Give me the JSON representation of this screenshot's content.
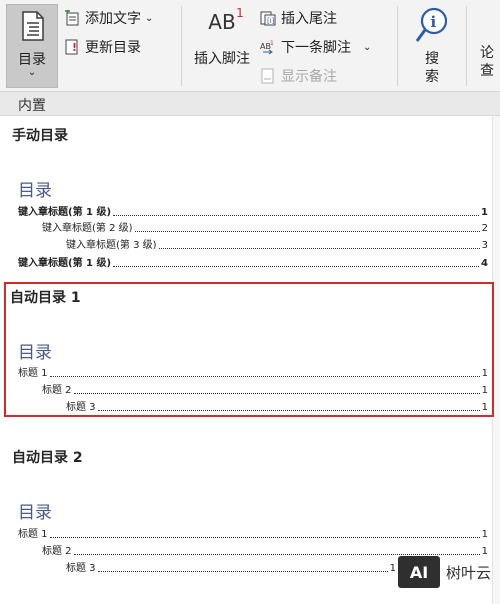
{
  "ribbon": {
    "toc_button_label": "目录",
    "add_text_label": "添加文字",
    "update_toc_label": "更新目录",
    "insert_footnote_label": "插入脚注",
    "insert_endnote_label": "插入尾注",
    "next_footnote_label": "下一条脚注",
    "show_notes_label": "显示备注",
    "search_label_1": "搜",
    "search_label_2": "索",
    "cut_label_1": "论",
    "cut_label_2": "查"
  },
  "gallery": {
    "header": "内置",
    "manual": {
      "section_title": "手动目录",
      "heading": "目录",
      "entries": [
        {
          "text": "键入章标题(第 1 级)",
          "page": "1"
        },
        {
          "text": "键入章标题(第 2 级)",
          "page": "2"
        },
        {
          "text": "键入章标题(第 3 级)",
          "page": "3"
        },
        {
          "text": "键入章标题(第 1 级)",
          "page": "4"
        }
      ]
    },
    "auto1": {
      "section_title": "自动目录 1",
      "heading": "目录",
      "entries": [
        {
          "text": "标题 1",
          "page": "1"
        },
        {
          "text": "标题 2",
          "page": "1"
        },
        {
          "text": "标题 3",
          "page": "1"
        }
      ]
    },
    "auto2": {
      "section_title": "自动目录 2",
      "heading": "目录",
      "entries": [
        {
          "text": "标题 1",
          "page": "1"
        },
        {
          "text": "标题 2",
          "page": "1"
        },
        {
          "text": "标题 3",
          "page": "1"
        }
      ]
    }
  },
  "watermark": {
    "logo_text": "AI",
    "text": "树叶云"
  },
  "colors": {
    "highlight_border": "#d12b2b",
    "heading_text": "#4a5a8c",
    "ribbon_bg": "#f3f3f3"
  }
}
